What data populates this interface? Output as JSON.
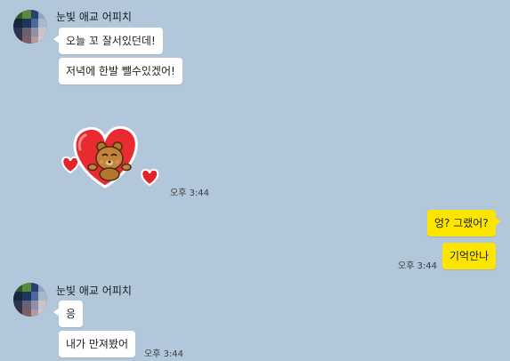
{
  "messages": {
    "group1": {
      "sender": "눈빛 애교 어피치",
      "bubble1": "오늘 꼬 잘서있던데!",
      "bubble2": "저녁에 한발 뺄수있겠어!",
      "sticker": "heart-bear-sticker",
      "time": "오후 3:44"
    },
    "mine": {
      "bubble1": "엉? 그랬어?",
      "bubble2": "기억안나",
      "time": "오후 3:44"
    },
    "group2": {
      "sender": "눈빛 애교 어피치",
      "bubble1": "응",
      "bubble2": "내가 만져봤어",
      "time": "오후 3:44"
    }
  },
  "colors": {
    "background": "#b2c7da",
    "my_bubble": "#fee500",
    "their_bubble": "#ffffff"
  }
}
